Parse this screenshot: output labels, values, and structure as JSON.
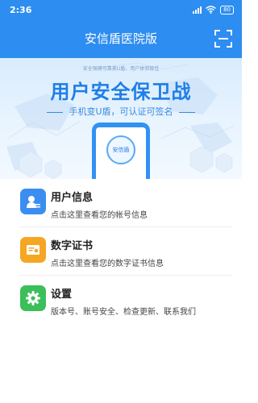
{
  "status_bar": {
    "time": "2:36",
    "battery": "80",
    "icons": [
      "signal-icon",
      "wifi-icon",
      "battery-icon"
    ]
  },
  "app_bar": {
    "title": "安信盾医院版",
    "scan_icon": "scan-icon"
  },
  "banner": {
    "tagline": "安全强健可靠美U盾，用户体验极佳",
    "headline": "用户安全保卫战",
    "subline": "手机变U盾，可认证可签名",
    "phone_label": "安信盾"
  },
  "menu": {
    "items": [
      {
        "label": "用户信息",
        "desc": "点击这里查看您的帐号信息",
        "icon": "user-card-icon",
        "color": "#3b8ef0"
      },
      {
        "label": "数字证书",
        "desc": "点击这里查看您的数字证书信息",
        "icon": "certificate-icon",
        "color": "#f5a623"
      },
      {
        "label": "设置",
        "desc": "版本号、账号安全、检查更新、联系我们",
        "icon": "gear-icon",
        "color": "#3bbf5a"
      }
    ]
  },
  "colors": {
    "primary": "#2d8df0",
    "headline": "#1f7ee8"
  }
}
